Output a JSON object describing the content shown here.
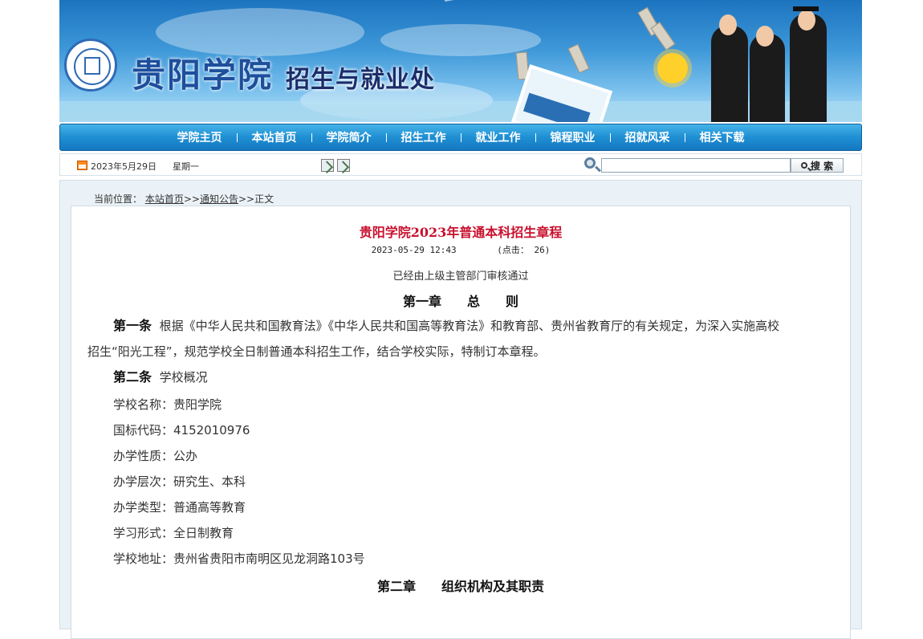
{
  "header": {
    "logo_main": "贵阳学院",
    "logo_sub": "招生与就业处"
  },
  "nav": {
    "items": [
      "学院主页",
      "本站首页",
      "学院简介",
      "招生工作",
      "就业工作",
      "锦程职业",
      "招就风采",
      "相关下载"
    ]
  },
  "infobar": {
    "date": "2023年5月29日",
    "weekday": "星期一",
    "search_placeholder": "",
    "search_button": "搜 索"
  },
  "breadcrumb": {
    "prefix": "当前位置：",
    "home": "本站首页",
    "sep1": ">>",
    "section": "通知公告",
    "sep2": ">>",
    "current": "正文"
  },
  "article": {
    "title": "贵阳学院2023年普通本科招生章程",
    "datetime": "2023-05-29 12:43",
    "clicks": "(点击： 26)",
    "approved": "已经由上级主管部门审核通过",
    "chapter1": "第一章　　总　　则",
    "art1_label": "第一条",
    "art1_text": "根据《中华人民共和国教育法》《中华人民共和国高等教育法》和教育部、贵州省教育厅的有关规定，为深入实施高校",
    "art1_text2": "招生“阳光工程”，规范学校全日制普通本科招生工作，结合学校实际，特制订本章程。",
    "art2_label": "第二条",
    "art2_text": "学校概况",
    "info_lines": [
      "学校名称：贵阳学院",
      "国标代码：4152010976",
      "办学性质：公办",
      "办学层次：研究生、本科",
      "办学类型：普通高等教育",
      "学习形式：全日制教育",
      "学校地址：贵州省贵阳市南明区见龙洞路103号"
    ],
    "chapter2": "第二章　　组织机构及其职责"
  },
  "colors": {
    "nav_bg": "#1f8fd3",
    "title_red": "#c8102e",
    "page_bg": "#eaf2f7"
  }
}
